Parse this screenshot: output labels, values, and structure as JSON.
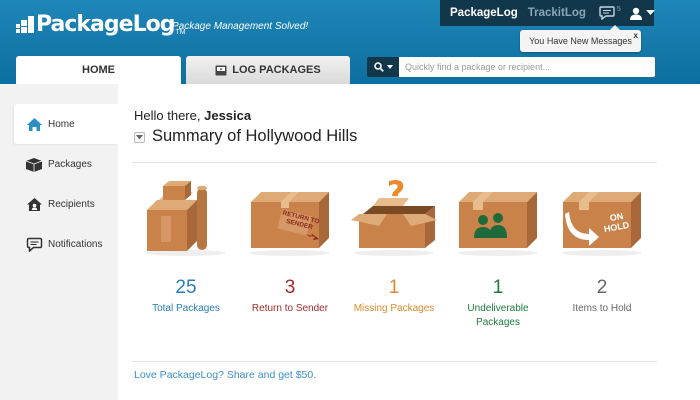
{
  "brand": {
    "name": "PackageLog",
    "tm": "TM",
    "tagline": "Package Management Solved!"
  },
  "topnav": {
    "active": "PackageLog",
    "other": "TrackitLog",
    "message_count": "5"
  },
  "tooltip": {
    "text": "You Have New Messages",
    "close": "x"
  },
  "tabs": {
    "home": "HOME",
    "log": "LOG PACKAGES"
  },
  "search": {
    "placeholder": "Quickly find a package or recipient..."
  },
  "sidebar": {
    "items": [
      {
        "label": "Home",
        "icon": "home-icon"
      },
      {
        "label": "Packages",
        "icon": "packages-icon"
      },
      {
        "label": "Recipients",
        "icon": "recipients-icon"
      },
      {
        "label": "Notifications",
        "icon": "notifications-icon"
      }
    ]
  },
  "main": {
    "greeting_prefix": "Hello there,",
    "user_name": "Jessica",
    "summary_title": "Summary of Hollywood Hills",
    "stats": [
      {
        "value": "25",
        "label": "Total Packages",
        "color": "#2a7db8"
      },
      {
        "value": "3",
        "label": "Return to Sender",
        "color": "#a32a2a"
      },
      {
        "value": "1",
        "label": "Missing Packages",
        "color": "#e08a2a"
      },
      {
        "value": "1",
        "label": "Undeliverable Packages",
        "color": "#1e7a3e"
      },
      {
        "value": "2",
        "label": "Items to Hold",
        "color": "#666666"
      }
    ],
    "box_text": {
      "return": "RETURN TO SENDER",
      "hold": "ON HOLD",
      "question": "?"
    },
    "share_text": "Love PackageLog? Share and get $50."
  },
  "colors": {
    "header": "#1279ab",
    "nav_dark": "#12374b",
    "box": "#c8824a",
    "link": "#3a8fc8"
  }
}
